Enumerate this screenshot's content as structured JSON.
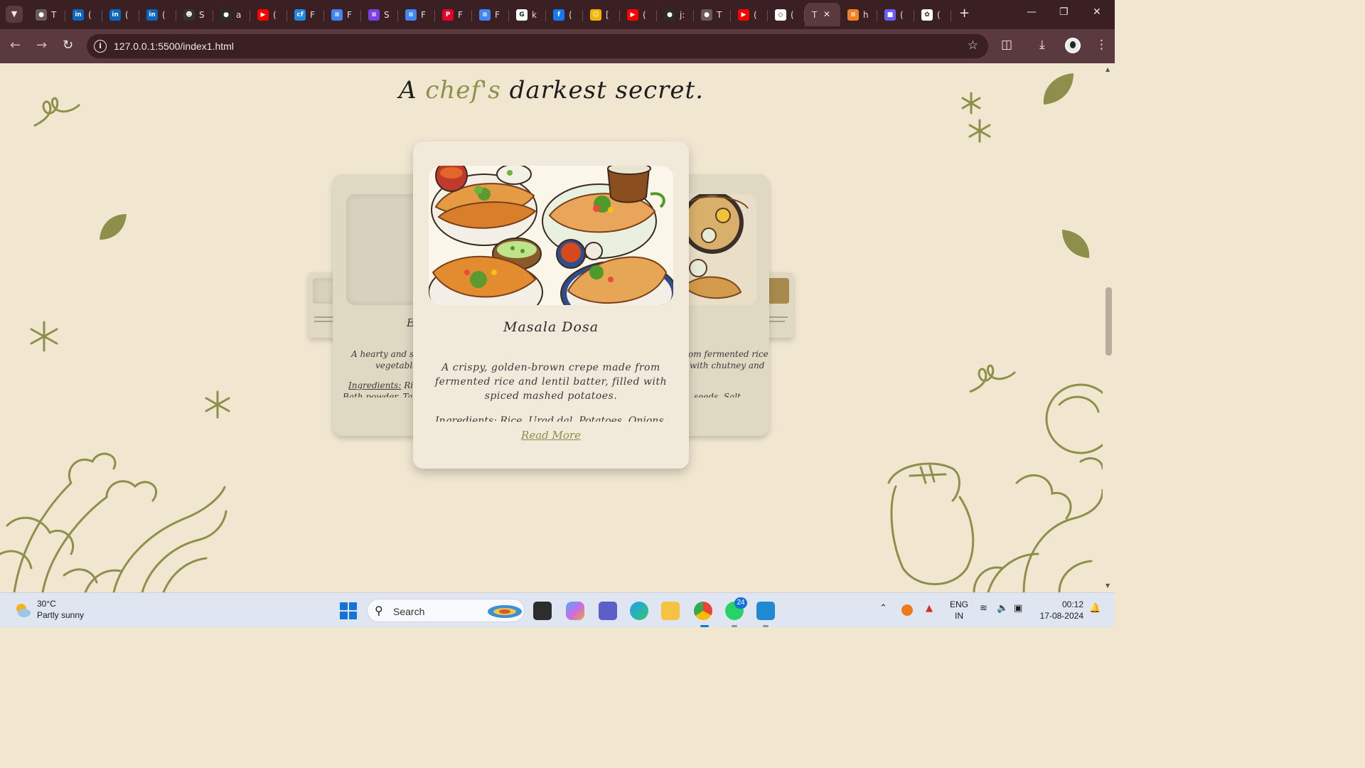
{
  "browser": {
    "tabs": [
      {
        "title": "T",
        "icon": "globe-icon",
        "color": "#6b5a5c"
      },
      {
        "title": "(",
        "icon": "linkedin-icon",
        "color": "#0a66c2"
      },
      {
        "title": "(",
        "icon": "linkedin-icon",
        "color": "#0a66c2"
      },
      {
        "title": "(",
        "icon": "linkedin-icon",
        "color": "#0a66c2"
      },
      {
        "title": "S",
        "icon": "profile-photo-icon",
        "color": "#333333"
      },
      {
        "title": "a",
        "icon": "github-icon",
        "color": "#2b2b2b"
      },
      {
        "title": "(",
        "icon": "youtube-icon",
        "color": "#ff0000"
      },
      {
        "title": "F",
        "icon": "codeforces-icon",
        "color": "#1e88e5"
      },
      {
        "title": "F",
        "icon": "docs-icon",
        "color": "#4285f4"
      },
      {
        "title": "S",
        "icon": "forms-icon",
        "color": "#7b3fe4"
      },
      {
        "title": "F",
        "icon": "docs-icon",
        "color": "#4285f4"
      },
      {
        "title": "F",
        "icon": "pinterest-icon",
        "color": "#e60023"
      },
      {
        "title": "F",
        "icon": "docs-icon",
        "color": "#4285f4"
      },
      {
        "title": "k",
        "icon": "google-icon",
        "color": "#ffffff"
      },
      {
        "title": "(",
        "icon": "facebook-icon",
        "color": "#1877f2"
      },
      {
        "title": "[",
        "icon": "emoji-icon",
        "color": "#f4b400"
      },
      {
        "title": "(",
        "icon": "youtube-icon",
        "color": "#ff0000"
      },
      {
        "title": "j:",
        "icon": "github-icon",
        "color": "#2b2b2b"
      },
      {
        "title": "T",
        "icon": "globe-icon",
        "color": "#6b5a5c"
      },
      {
        "title": "(",
        "icon": "youtube-icon",
        "color": "#ff0000"
      },
      {
        "title": "(",
        "icon": "codepen-icon",
        "color": "#ffffff"
      }
    ],
    "active_tab": {
      "title": "T"
    },
    "tabs_after": [
      {
        "title": "h",
        "icon": "stackoverflow-icon",
        "color": "#f48024"
      },
      {
        "title": "(",
        "icon": "app-icon",
        "color": "#6a5cff"
      },
      {
        "title": "(",
        "icon": "chatgpt-icon",
        "color": "#ffffff"
      }
    ],
    "url": "127.0.0.1:5500/index1.html"
  },
  "page": {
    "heading_pre": "A ",
    "heading_accent": "chef's",
    "heading_post": " darkest secret.",
    "accent_color": "#8d8f4a",
    "left_card": {
      "title_fragment": "E",
      "desc_line1": "A hearty and sp",
      "desc_line2": "vegetables",
      "ingredients_label": "Ingredients:",
      "ingredients_text": "Ric",
      "ingredients_line2": "Bath powder, Ta"
    },
    "right_card": {
      "desc_line1": "om fermented rice",
      "desc_line2": "with chutney and",
      "ingredients_line": "seeds, Salt"
    },
    "main_card": {
      "title": "Masala Dosa",
      "description": "A crispy, golden-brown crepe made from fermented rice and lentil batter, filled with spiced mashed potatoes.",
      "ingredients": "Ingredients: Rice, Urad dal, Potatoes, Onions,",
      "read_more": "Read More"
    }
  },
  "taskbar": {
    "weather_temp": "30°C",
    "weather_desc": "Partly sunny",
    "search_label": "Search",
    "whatsapp_badge": "24",
    "lang_line1": "ENG",
    "lang_line2": "IN",
    "time": "00:12",
    "date": "17-08-2024"
  }
}
